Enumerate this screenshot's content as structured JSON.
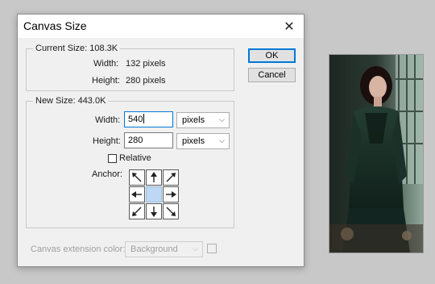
{
  "dialog": {
    "title": "Canvas Size",
    "close_icon": "close-icon"
  },
  "current_size": {
    "legend": "Current Size: 108.3K",
    "width_label": "Width:",
    "width_value": "132 pixels",
    "height_label": "Height:",
    "height_value": "280 pixels"
  },
  "new_size": {
    "legend": "New Size: 443.0K",
    "width_label": "Width:",
    "width_value": "540",
    "width_unit": "pixels",
    "height_label": "Height:",
    "height_value": "280",
    "height_unit": "pixels",
    "relative_label": "Relative",
    "relative_checked": false,
    "anchor_label": "Anchor:",
    "anchor_selected": "center"
  },
  "buttons": {
    "ok": "OK",
    "cancel": "Cancel"
  },
  "extension": {
    "label": "Canvas extension color:",
    "value": "Background",
    "enabled": false
  },
  "colors": {
    "accent": "#0078d7",
    "anchor_selected": "#bcd8f5",
    "dialog_bg": "#f0f0f0",
    "workspace_bg": "#c8c8c8"
  }
}
